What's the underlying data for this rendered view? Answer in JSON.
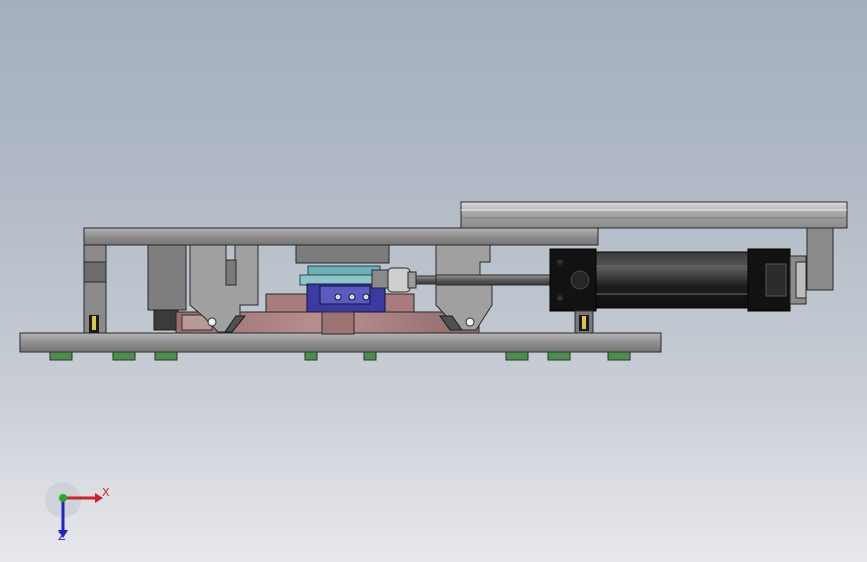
{
  "viewport": {
    "background_top": "#a4afbd",
    "background_bottom": "#e8e9ec",
    "model_color": "#8c8c8c",
    "base_color": "#9a9a9a",
    "bolt_color": "#4a8a4a",
    "fixture_color": "#b08888",
    "gripper_color": "#2a2a90",
    "cylinder_color": "#1e1e1e"
  },
  "triad": {
    "x_label": "X",
    "z_label": "Z",
    "x_color": "#d22222",
    "y_color": "#22aa22",
    "z_color": "#2222cc"
  }
}
